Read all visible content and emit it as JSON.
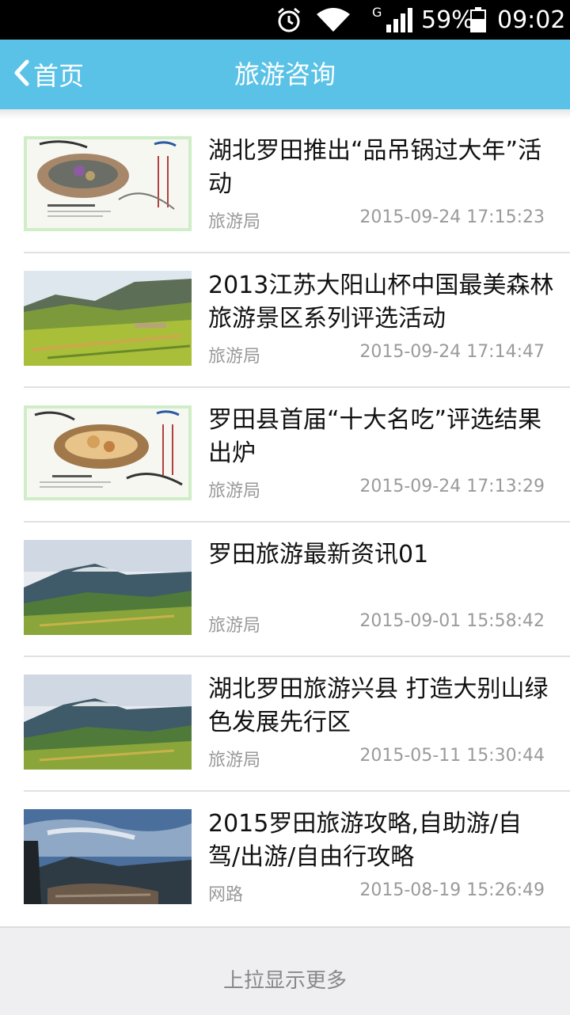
{
  "status_bar": {
    "signal_label": "G",
    "battery": "59%",
    "time": "09:02",
    "icons": [
      "alarm-icon",
      "wifi-icon",
      "signal-icon",
      "battery-icon"
    ]
  },
  "header": {
    "back_label": "首页",
    "title": "旅游咨询",
    "color": "#5ac2e6"
  },
  "articles": [
    {
      "title": "湖北罗田推出“品吊锅过大年”活动",
      "source": "旅游局",
      "date": "2015-09-24 17:15:23",
      "thumb": "food-poster"
    },
    {
      "title": "2013江苏大阳山杯中国最美森林旅游景区系列评选活动",
      "source": "旅游局",
      "date": "2015-09-24 17:14:47",
      "thumb": "valley-landscape"
    },
    {
      "title": "罗田县首届“十大名吃”评选结果出炉",
      "source": "旅游局",
      "date": "2015-09-24 17:13:29",
      "thumb": "food-poster"
    },
    {
      "title": "罗田旅游最新资讯01",
      "source": "旅游局",
      "date": "2015-09-01 15:58:42",
      "thumb": "mountain-landscape"
    },
    {
      "title": "湖北罗田旅游兴县 打造大别山绿色发展先行区",
      "source": "旅游局",
      "date": "2015-05-11 15:30:44",
      "thumb": "mountain-landscape"
    },
    {
      "title": "2015罗田旅游攻略,自助游/自 驾/出游/自由行攻略",
      "source": "网路",
      "date": "2015-08-19 15:26:49",
      "thumb": "cliff-landscape"
    }
  ],
  "footer": {
    "load_more": "上拉显示更多"
  }
}
